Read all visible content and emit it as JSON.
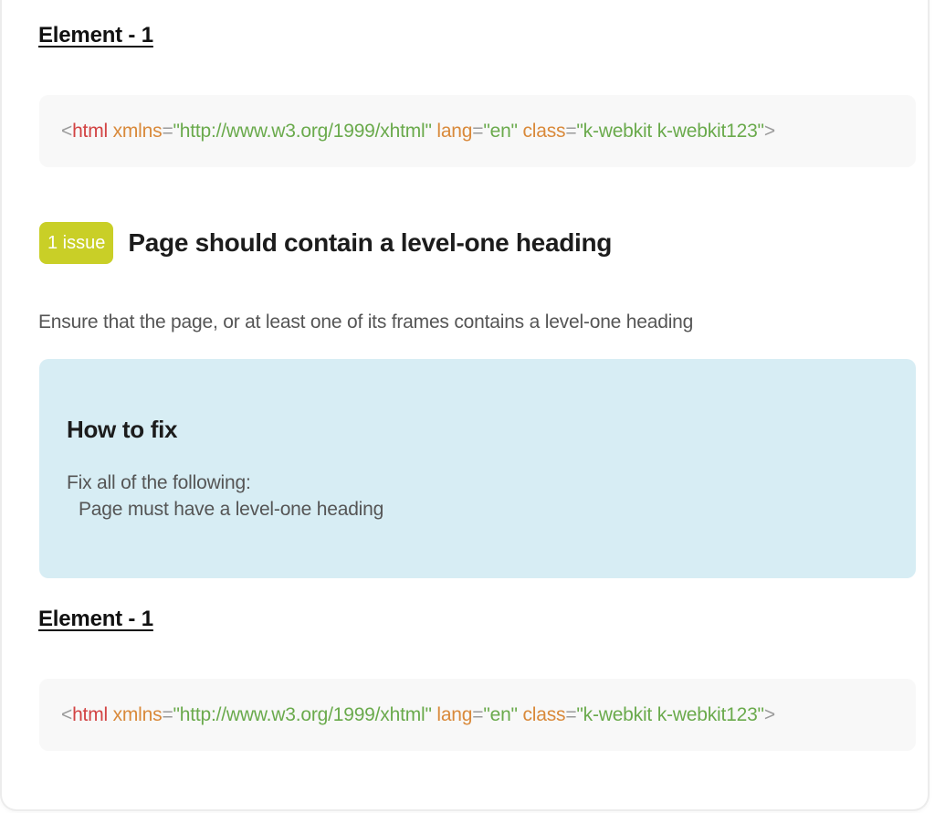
{
  "sections": [
    {
      "element_title": "Element - 1",
      "code": {
        "open": "<",
        "tag": "html",
        "attr1": "xmlns",
        "eq1": "=",
        "val1": "\"http://www.w3.org/1999/xhtml\"",
        "attr2": "lang",
        "eq2": "=",
        "val2": "\"en\"",
        "attr3": "class",
        "eq3": "=",
        "val3": "\"k-webkit k-webkit123\"",
        "close": ">"
      }
    },
    {
      "element_title": "Element - 1",
      "code": {
        "open": "<",
        "tag": "html",
        "attr1": "xmlns",
        "eq1": "=",
        "val1": "\"http://www.w3.org/1999/xhtml\"",
        "attr2": "lang",
        "eq2": "=",
        "val2": "\"en\"",
        "attr3": "class",
        "eq3": "=",
        "val3": "\"k-webkit k-webkit123\"",
        "close": ">"
      }
    }
  ],
  "issue": {
    "badge": "1 issue",
    "title": "Page should contain a level-one heading",
    "description": "Ensure that the page, or at least one of its frames contains a level-one heading",
    "badge_color": "#c9cf27"
  },
  "fix": {
    "heading": "How to fix",
    "line1": "Fix all of the following:",
    "line2": "Page must have a level-one heading",
    "background": "#d7edf4"
  },
  "colors": {
    "tag": "#d24343",
    "attr": "#d9893a",
    "value": "#6aaa4c",
    "punct": "#9a9a9a"
  }
}
